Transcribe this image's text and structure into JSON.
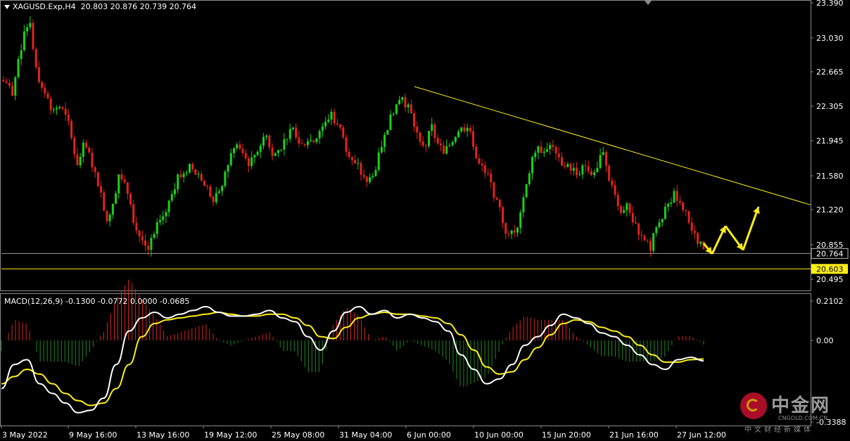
{
  "header": {
    "symbol": "XAGUSD.Exp,H4",
    "ohlc": "20.803 20.876 20.739 20.764"
  },
  "macd_header": "MACD(12,26,9) -0.1300 -0.0772 0.0000 -0.0685",
  "colors": {
    "bull": "#19d119",
    "bear": "#e0241b",
    "signal": "#ffef14",
    "macd_line": "#ffffff",
    "hist_pos": "#d9261c",
    "hist_neg": "#1f8a1f",
    "grid_line": "#9a9a9a",
    "support": "#ffef14"
  },
  "watermark": {
    "brand": "中金网",
    "domain": "CNGOLD.COM.CN",
    "tagline": "中文财经新媒体"
  },
  "chart_data": [
    {
      "type": "candlestick",
      "title": "XAGUSD.Exp,H4",
      "y_ticks": [
        "23.390",
        "23.030",
        "22.665",
        "22.305",
        "21.945",
        "21.580",
        "21.220",
        "20.855",
        "20.495"
      ],
      "ylim": [
        20.4,
        23.4
      ],
      "x_labels": [
        "3 May 2022",
        "9 May 16:00",
        "13 May 16:00",
        "19 May 12:00",
        "25 May 08:00",
        "31 May 04:00",
        "6 Jun 00:00",
        "10 Jun 00:00",
        "15 Jun 20:00",
        "21 Jun 16:00",
        "27 Jun 12:00"
      ],
      "current_price": {
        "label": "20.764",
        "value": 20.764
      },
      "support_level": {
        "label": "20.603",
        "value": 20.603
      },
      "close_path": [
        22.55,
        22.4,
        22.8,
        23.1,
        23.2,
        22.7,
        22.5,
        22.4,
        22.25,
        22.3,
        22.2,
        22.0,
        21.7,
        21.9,
        21.8,
        21.6,
        21.4,
        21.1,
        21.3,
        21.6,
        21.5,
        21.3,
        21.0,
        20.9,
        20.8,
        20.95,
        21.1,
        21.2,
        21.4,
        21.6,
        21.6,
        21.7,
        21.6,
        21.55,
        21.45,
        21.3,
        21.4,
        21.6,
        21.8,
        21.9,
        21.8,
        21.7,
        21.8,
        21.9,
        22.0,
        21.8,
        21.85,
        21.95,
        22.05,
        22.0,
        21.9,
        21.95,
        21.95,
        22.05,
        22.15,
        22.25,
        22.1,
        22.0,
        21.8,
        21.7,
        21.6,
        21.5,
        21.6,
        21.8,
        22.0,
        22.2,
        22.35,
        22.4,
        22.3,
        22.1,
        21.95,
        21.9,
        22.1,
        21.9,
        21.8,
        21.9,
        22.0,
        22.1,
        22.1,
        21.9,
        21.7,
        21.6,
        21.5,
        21.3,
        21.1,
        20.95,
        21.0,
        21.2,
        21.5,
        21.8,
        21.9,
        21.85,
        21.9,
        21.8,
        21.7,
        21.7,
        21.65,
        21.6,
        21.7,
        21.6,
        21.65,
        21.85,
        21.55,
        21.4,
        21.2,
        21.3,
        21.1,
        20.95,
        20.9,
        20.8,
        21.05,
        21.1,
        21.3,
        21.4,
        21.3,
        21.2,
        21.0,
        20.85,
        20.8
      ],
      "trendline": {
        "from": [
          "6 Jun 00:00",
          22.51
        ],
        "to": [
          "27 Jun 12:00+",
          21.27
        ]
      },
      "projection_arrows": [
        [
          20.87,
          20.76
        ],
        [
          20.76,
          21.05
        ],
        [
          21.05,
          20.8
        ],
        [
          20.8,
          21.25
        ]
      ]
    },
    {
      "type": "line",
      "title": "MACD(12,26,9)",
      "y_ticks": [
        "0.2102",
        "0.00",
        "-0.3388"
      ],
      "ylim": [
        -0.3388,
        0.2102
      ],
      "series": [
        {
          "name": "MACD",
          "values": [
            -0.2,
            -0.1,
            -0.08,
            -0.18,
            -0.22,
            -0.26,
            -0.3,
            -0.29,
            -0.24,
            -0.1,
            0.05,
            0.12,
            0.15,
            0.12,
            0.14,
            0.16,
            0.18,
            0.15,
            0.13,
            0.13,
            0.14,
            0.16,
            0.12,
            0.1,
            0.02,
            -0.04,
            0.05,
            0.15,
            0.18,
            0.14,
            0.16,
            0.12,
            0.14,
            0.12,
            0.1,
            0.05,
            -0.06,
            -0.12,
            -0.18,
            -0.16,
            -0.1,
            -0.02,
            0.02,
            0.08,
            0.14,
            0.12,
            0.09,
            0.04,
            0.02,
            -0.02,
            -0.06,
            -0.1,
            -0.12,
            -0.08,
            -0.07,
            -0.085
          ]
        },
        {
          "name": "Signal",
          "values": [
            -0.18,
            -0.15,
            -0.12,
            -0.14,
            -0.18,
            -0.22,
            -0.25,
            -0.27,
            -0.26,
            -0.2,
            -0.1,
            0.02,
            0.09,
            0.11,
            0.12,
            0.13,
            0.14,
            0.15,
            0.14,
            0.13,
            0.13,
            0.14,
            0.14,
            0.12,
            0.08,
            0.02,
            0.01,
            0.07,
            0.12,
            0.14,
            0.15,
            0.14,
            0.14,
            0.13,
            0.12,
            0.09,
            0.03,
            -0.04,
            -0.11,
            -0.14,
            -0.13,
            -0.08,
            -0.03,
            0.03,
            0.09,
            0.11,
            0.1,
            0.07,
            0.05,
            0.02,
            -0.02,
            -0.06,
            -0.09,
            -0.09,
            -0.08,
            -0.077
          ]
        }
      ]
    }
  ]
}
